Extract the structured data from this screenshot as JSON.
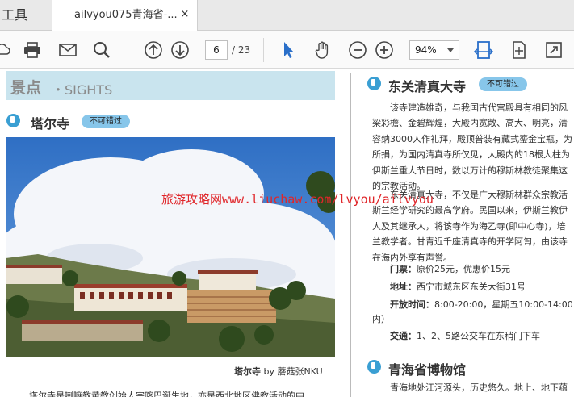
{
  "tabbar": {
    "tools_label": "工具",
    "doc_tab_title": "ailvyou075青海省-...",
    "close_glyph": "×"
  },
  "toolbar": {
    "current_page": "6",
    "total_pages": "/ 23",
    "zoom": "94%"
  },
  "left": {
    "section_title": "景点",
    "section_subtitle": "・SIGHTS",
    "attraction_title": "塔尔寺",
    "attraction_badge": "不可错过",
    "caption_name": "塔尔寺",
    "caption_credit": "by 蘑菇张NKU",
    "cut_text": "塔尔寺是喇嘛教黄教创始人宗喀巴诞生地，亦是西北地区佛教活动的中"
  },
  "right": {
    "title1": "东关清真大寺",
    "badge1": "不可错过",
    "para1": [
      "　　该寺建造雄奇，与我国古代宫殿具有相同的风",
      "梁彩檐、金碧辉煌，大殿内宽敞、高大、明亮，清",
      "容纳3000人作礼拜，殿顶普装有藏式鎏金宝瓶，为",
      "所捐，为国内清真寺所仅见，大殿内的18根大柱为",
      "伊斯兰重大节日时，数以万计的穆斯林教徒聚集这",
      "的宗教活动。"
    ],
    "para2": [
      "　　东关清真大寺，不仅是广大穆斯林群众宗教活",
      "斯兰经学研究的最高学府。民国以来，伊斯兰教伊",
      "人及其继承人，将该寺作为海乙寺(即中心寺)，培",
      "兰教学者。甘青近千座清真寺的开学阿訇，由该寺",
      "在海内外享有声誉。"
    ],
    "tickets_label": "门票：",
    "tickets_value": "原价25元，优惠价15元",
    "address_label": "地址：",
    "address_value": "西宁市城东区东关大街31号",
    "hours_label": "开放时间：",
    "hours_value": "8:00-20:00，星期五10:00-14:00",
    "hours_cont": "内）",
    "transport_label": "交通：",
    "transport_value": "1、2、5路公交车在东稍门下车",
    "title2": "青海省博物馆",
    "para3": "　　青海地处江河源头，历史悠久。地上、地下蕴"
  },
  "watermark": "旅游攻略网www.liuchaw.com/lvyou/ailvyou",
  "colors": {
    "accent": "#3a9fd3",
    "badge": "#87c6ea",
    "sights_bar": "#c9e4ee",
    "watermark": "#e0262a"
  }
}
